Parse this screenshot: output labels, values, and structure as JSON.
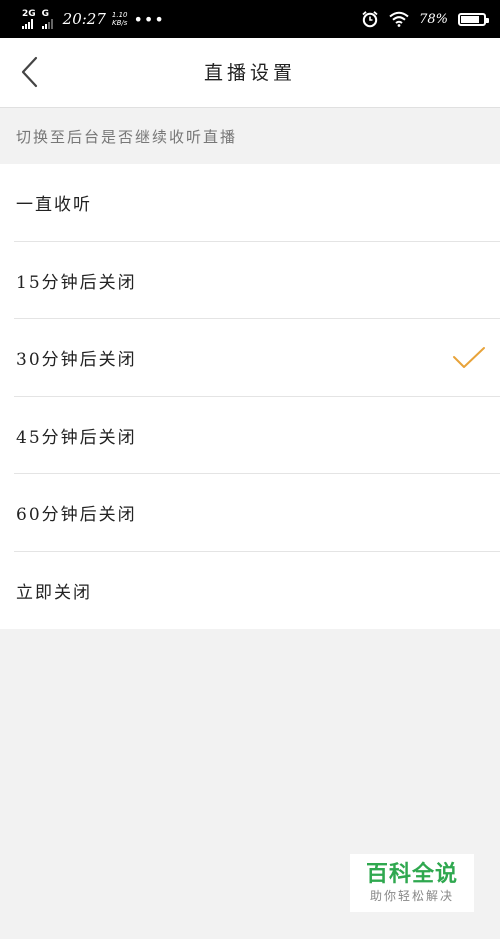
{
  "status_bar": {
    "network1": "2G",
    "network2": "G",
    "time": "20:27",
    "speed_value": "1.10",
    "speed_unit": "KB/s",
    "more": "•••",
    "battery_percent": "78%"
  },
  "header": {
    "title": "直播设置",
    "back_icon": "chevron-left-icon"
  },
  "section": {
    "caption": "切换至后台是否继续收听直播"
  },
  "options": [
    {
      "label": "一直收听",
      "selected": false
    },
    {
      "label": "15分钟后关闭",
      "selected": false
    },
    {
      "label": "30分钟后关闭",
      "selected": true
    },
    {
      "label": "45分钟后关闭",
      "selected": false
    },
    {
      "label": "60分钟后关闭",
      "selected": false
    },
    {
      "label": "立即关闭",
      "selected": false
    }
  ],
  "colors": {
    "check": "#e8a33a",
    "watermark": "#2fa84f"
  },
  "watermark": {
    "main": "百科全说",
    "sub": "助你轻松解决"
  }
}
